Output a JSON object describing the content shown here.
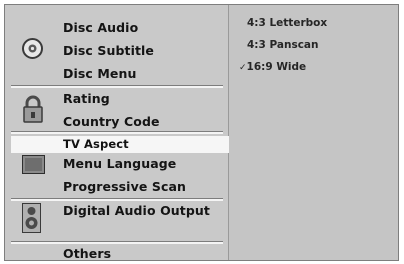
{
  "menu": {
    "groups": [
      {
        "icon": "disc-icon",
        "items": [
          "Disc Audio",
          "Disc Subtitle",
          "Disc Menu"
        ]
      },
      {
        "icon": "lock-icon",
        "items": [
          "Rating",
          "Country Code"
        ]
      },
      {
        "icon": "tv-icon",
        "items": [
          "TV Aspect",
          "Menu Language",
          "Progressive Scan"
        ],
        "selected": 0
      },
      {
        "icon": "speaker-icon",
        "items": [
          "Digital Audio Output"
        ]
      },
      {
        "icon": "",
        "items": [
          "Others"
        ]
      }
    ]
  },
  "options": {
    "title": "TV Aspect",
    "items": [
      "4:3  Letterbox",
      "4:3  Panscan",
      "16:9 Wide"
    ],
    "checked_index": 2,
    "check_mark": "✓"
  }
}
